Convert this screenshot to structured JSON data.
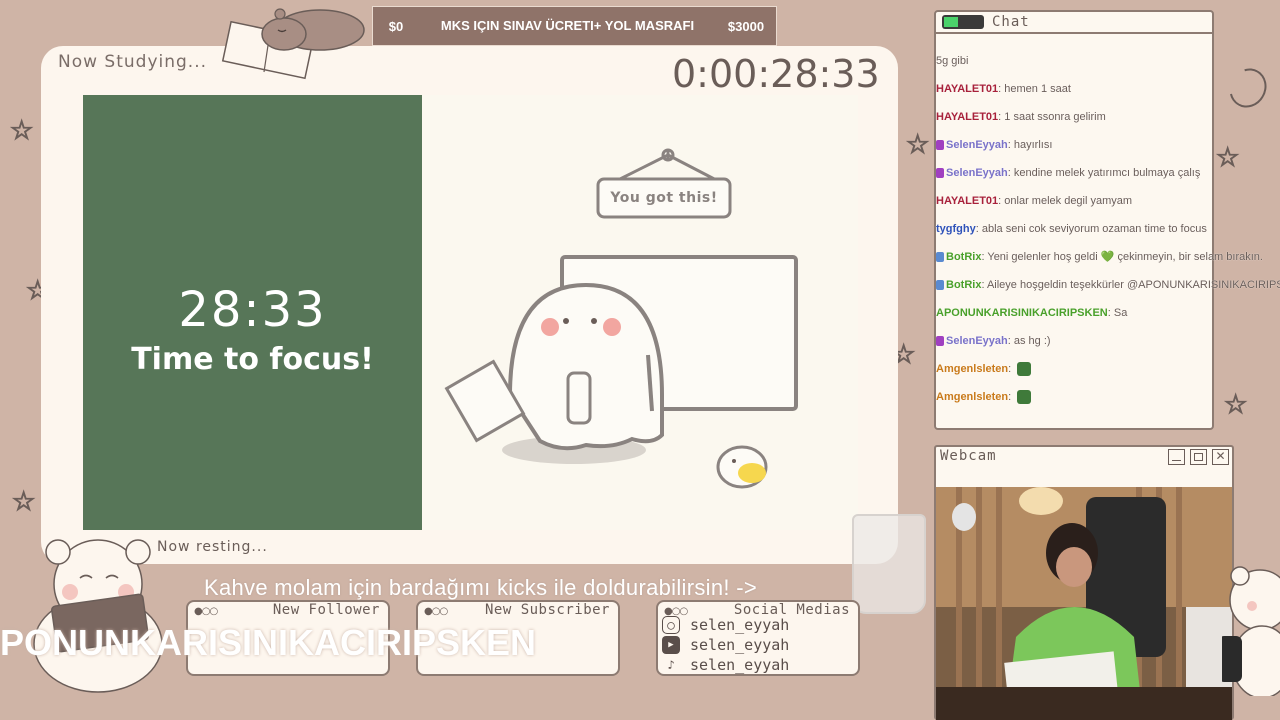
{
  "goal": {
    "min": "$0",
    "title": "MKS IÇIN SINAV ÜCRETI+ YOL MASRAFI",
    "max": "$3000"
  },
  "study": {
    "title": "Now Studying...",
    "timer": "0:00:28:33",
    "green_time": "28:33",
    "green_message": "Time to focus!",
    "sign_text": "You got this!",
    "resting": "Now resting..."
  },
  "chat": {
    "title": "Chat",
    "lines": [
      {
        "user": "",
        "text": "5g gibi",
        "color": "#6a5d58",
        "badge": ""
      },
      {
        "user": "HAYALET01",
        "text": ": hemen 1 saat",
        "color": "#a8213a",
        "badge": ""
      },
      {
        "user": "HAYALET01",
        "text": ": 1 saat ssonra gelirim",
        "color": "#a8213a",
        "badge": ""
      },
      {
        "user": "SelenEyyah",
        "text": ": hayırlısı",
        "color": "#7a72c8",
        "badge": "#a040c0"
      },
      {
        "user": "SelenEyyah",
        "text": ": kendine melek yatırımcı bulmaya çalış",
        "color": "#7a72c8",
        "badge": "#a040c0"
      },
      {
        "user": "HAYALET01",
        "text": ": onlar melek degil yamyam",
        "color": "#a8213a",
        "badge": ""
      },
      {
        "user": "tygfghy",
        "text": ": abla seni cok seviyorum ozaman time to focus",
        "color": "#2f52b8",
        "badge": ""
      },
      {
        "user": "BotRix",
        "text": ": Yeni gelenler hoş geldi 💚 çekinmeyin, bir selam bırakın.",
        "color": "#4aa02a",
        "badge": "#5a8ad0"
      },
      {
        "user": "BotRix",
        "text": ": Aileye hoşgeldin teşekkürler @APONUNKARISINIKACIRIPSKEN",
        "color": "#4aa02a",
        "badge": "#5a8ad0"
      },
      {
        "user": "APONUNKARISINIKACIRIPSKEN",
        "text": ": Sa",
        "color": "#4aa02a",
        "badge": ""
      },
      {
        "user": "SelenEyyah",
        "text": ": as hg :)",
        "color": "#7a72c8",
        "badge": "#a040c0"
      },
      {
        "user": "Amgenlsleten",
        "text": ":",
        "color": "#c97a1a",
        "badge": ""
      },
      {
        "user": "Amgenlsleten",
        "text": ":",
        "color": "#c97a1a",
        "badge": ""
      }
    ]
  },
  "webcam": {
    "title": "Webcam"
  },
  "kick_message": "Kahve molam için bardağımı kicks ile doldurabilirsin! ->",
  "alerts": {
    "follower_title": "New Follower",
    "subscriber_title": "New Subscriber",
    "social_title": "Social Medias",
    "follower_name": "PONUNKARISINIKACIRIPSKEN",
    "socials": [
      {
        "icon": "instagram-icon",
        "handle": "selen_eyyah"
      },
      {
        "icon": "youtube-icon",
        "handle": "selen_eyyah"
      },
      {
        "icon": "tiktok-icon",
        "handle": "selen_eyyah"
      }
    ]
  },
  "colors": {
    "background": "#cfb4a6",
    "panel": "#fdf6ee",
    "focus_green": "#577658",
    "goal_bar": "#8f7369"
  }
}
